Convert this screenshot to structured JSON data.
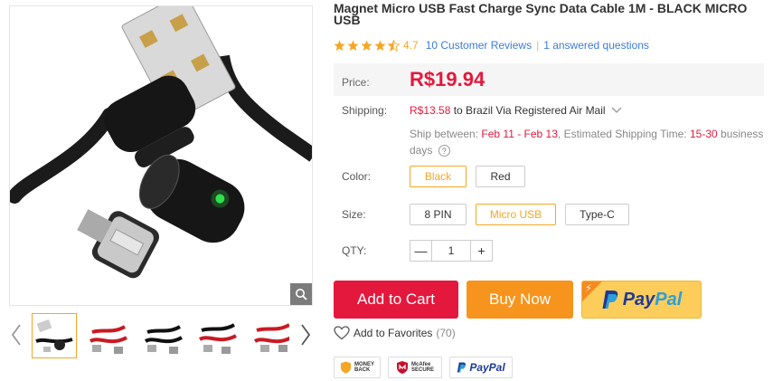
{
  "product": {
    "title": "Magnet Micro USB Fast Charge Sync Data Cable 1M - BLACK MICRO USB",
    "rating": "4.7",
    "reviews_link": "10 Customer Reviews",
    "separator": "|",
    "questions_link": "1 answered questions"
  },
  "price": {
    "label": "Price:",
    "value": "R$19.94"
  },
  "shipping": {
    "label": "Shipping:",
    "cost": "R$13.58",
    "destination": "to Brazil Via Registered Air Mail",
    "ship_between_label": "Ship between:",
    "ship_between_value": "Feb 11 - Feb 13",
    "est_label": ", Estimated Shipping Time:",
    "est_value": "15-30",
    "est_unit": "business days"
  },
  "color": {
    "label": "Color:",
    "options": [
      "Black",
      "Red"
    ],
    "selected": "Black"
  },
  "size": {
    "label": "Size:",
    "options": [
      "8 PIN",
      "Micro USB",
      "Type-C"
    ],
    "selected": "Micro USB"
  },
  "qty": {
    "label": "QTY:",
    "value": "1",
    "minus": "—",
    "plus": "+"
  },
  "actions": {
    "add_to_cart": "Add to Cart",
    "buy_now": "Buy Now",
    "paypal_pay": "Pay",
    "paypal_pal": "Pal"
  },
  "favorites": {
    "label": "Add to Favorites",
    "count": "(70)"
  },
  "badges": {
    "money_back_l1": "MONEY",
    "money_back_l2": "BACK",
    "mcafee_l1": "McAfee",
    "mcafee_l2": "SECURE",
    "paypal": "PayPal"
  },
  "colors": {
    "accent_red": "#e4183c",
    "accent_orange": "#f7941d",
    "star": "#f5a623",
    "link_blue": "#3d7bd9",
    "paypal_yellow": "#fccd5b"
  },
  "icons": {
    "zoom": "magnifier-icon",
    "prev": "chevron-left-icon",
    "next": "chevron-right-icon",
    "favorite": "heart-icon",
    "help": "question-circle-icon",
    "dropdown": "chevron-down-icon"
  },
  "gallery": {
    "thumb_count": 5,
    "selected_index": 0,
    "thumb_variants": [
      "black",
      "red",
      "black",
      "red",
      "red"
    ]
  }
}
